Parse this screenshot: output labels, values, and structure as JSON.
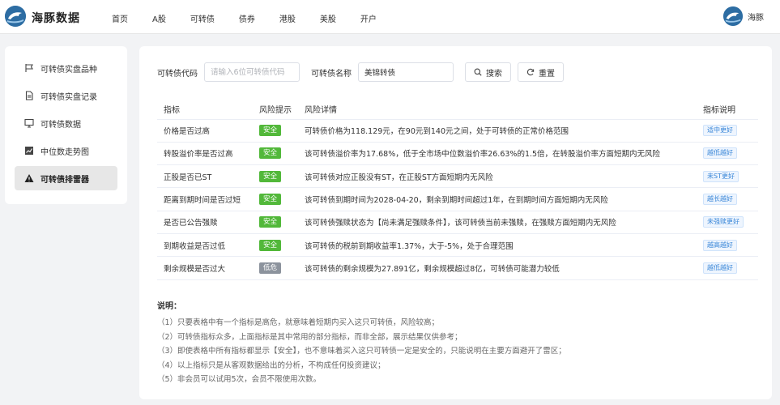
{
  "header": {
    "brand": "海豚数据",
    "nav": [
      "首页",
      "A股",
      "可转债",
      "债券",
      "港股",
      "美股",
      "开户"
    ],
    "user_name": "海豚"
  },
  "sidebar": {
    "items": [
      {
        "label": "可转债实盘品种",
        "icon": "flag-icon"
      },
      {
        "label": "可转债实盘记录",
        "icon": "document-icon"
      },
      {
        "label": "可转债数据",
        "icon": "monitor-icon"
      },
      {
        "label": "中位数走势图",
        "icon": "chart-icon"
      },
      {
        "label": "可转债排雷器",
        "icon": "warning-icon",
        "active": true
      }
    ]
  },
  "search": {
    "code_label": "可转债代码",
    "code_placeholder": "请输入6位可转债代码",
    "code_value": "",
    "name_label": "可转债名称",
    "name_value": "美锦转债",
    "search_button": "搜索",
    "reset_button": "重置"
  },
  "table": {
    "headers": [
      "指标",
      "风险提示",
      "风险详情",
      "指标说明"
    ],
    "rows": [
      {
        "indicator": "价格是否过高",
        "risk": "安全",
        "detail": "可转债价格为118.129元，在90元到140元之间，处于可转债的正常价格范围",
        "note": "适中更好"
      },
      {
        "indicator": "转股溢价率是否过高",
        "risk": "安全",
        "detail": "该可转债溢价率为17.68%，低于全市场中位数溢价率26.63%的1.5倍，在转股溢价率方面短期内无风险",
        "note": "越低越好"
      },
      {
        "indicator": "正股是否已ST",
        "risk": "安全",
        "detail": "该可转债对应正股没有ST，在正股ST方面短期内无风险",
        "note": "未ST更好"
      },
      {
        "indicator": "距离到期时间是否过短",
        "risk": "安全",
        "detail": "该可转债到期时间为2028-04-20，剩余到期时间超过1年，在到期时间方面短期内无风险",
        "note": "越长越好"
      },
      {
        "indicator": "是否已公告强赎",
        "risk": "安全",
        "detail": "该可转债强赎状态为【尚未满足强赎条件】，该可转债当前未强赎，在强赎方面短期内无风险",
        "note": "未强赎更好"
      },
      {
        "indicator": "到期收益是否过低",
        "risk": "安全",
        "detail": "该可转债的税前到期收益率1.37%，大于-5%，处于合理范围",
        "note": "越高越好"
      },
      {
        "indicator": "剩余规模是否过大",
        "risk": "低危",
        "detail": "该可转债的剩余规模为27.891亿，剩余规模超过8亿，可转债可能潜力较低",
        "note": "越低越好"
      }
    ]
  },
  "notes": {
    "title": "说明：",
    "items": [
      "（1）只要表格中有一个指标是高危，就意味着短期内买入这只可转债，风险较高；",
      "（2）可转债指标众多，上面指标是其中常用的部分指标，而非全部，展示结果仅供参考；",
      "（3）即使表格中所有指标都显示【安全】，也不意味着买入这只可转债一定是安全的，只能说明在主要方面避开了雷区；",
      "（4）以上指标只是从客观数据给出的分析，不构成任何投资建议；",
      "（5）非会员可以试用5次，会员不限使用次数。"
    ]
  },
  "colors": {
    "safe": "#52b83a",
    "low_risk": "#8c939d",
    "note_text": "#3a87d8"
  }
}
